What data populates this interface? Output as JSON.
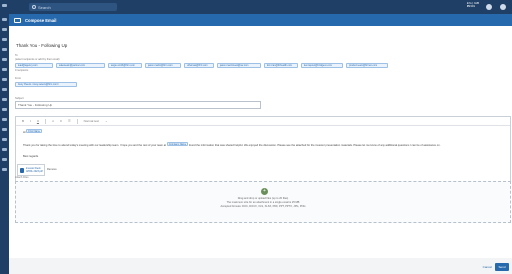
{
  "topbar": {
    "search_placeholder": "Search",
    "user_line1": "Info | IAB",
    "user_line2": "IBN01"
  },
  "modal": {
    "title": "Compose Email"
  },
  "form": {
    "subject_heading": "Thank You - Following Up",
    "to_label": "To",
    "to_note": "(select recipients or add by their email)",
    "recipients": [
      "lead@agency.com",
      "salesteam@partner.com",
      "angie.smith@firm.com",
      "jason.martin@firm.com",
      "uthomas@IFC.com",
      "jason.macrinvest@sw.com",
      "kim.tran@ifchealth.com",
      "ken.lapour@bridgeco.com",
      "product.team@firmco.com"
    ],
    "to_count": "9 recipients",
    "from_label": "From",
    "from_value": "Avoy Owens <avoy.owens@firm.com>",
    "subject_label": "Subject",
    "subject_value": "Thank You - Following Up",
    "editor_paragraph_label": "Normal text",
    "greeting_prefix": "Hi",
    "greeting_chip": "First Name",
    "body": "Thank you for taking the time to attend today's meeting with our leadership team. I hope you and the rest of your team at",
    "body_chip": "Company Name",
    "body_rest": "found the information that was shared helpful. We enjoyed the discussion. Please see the attached for the investor presentation materials. Please let me know of any additional questions I can be of assistance on.",
    "closing": "Best regards"
  },
  "attachment": {
    "name_line1": "Investor Deck",
    "name_line2": "APRIL 2023.pdf",
    "remove_label": "Remove"
  },
  "dropzone": {
    "label": "Attach Files",
    "line1": "Drag and drop or upload files (up to 20 files)",
    "line2": "The maximum size for an attachment in a single email is 25 MB",
    "line3": "Accepted formats: DOC, DOCX, XLS, XLSX, PDF, PPT, PPTX, JPG, PNG"
  },
  "footer": {
    "cancel_label": "Cancel",
    "send_label": "Send"
  },
  "colors": {
    "brand": "#1f3f66",
    "accent": "#2769ad"
  }
}
